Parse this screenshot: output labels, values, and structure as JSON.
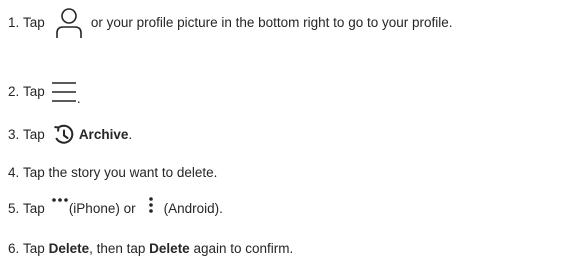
{
  "steps": [
    {
      "num": "1.",
      "pre": "Tap",
      "icon": "profile-icon",
      "post": "or your profile picture in the bottom right to go to your profile."
    },
    {
      "num": "2.",
      "pre": "Tap",
      "icon": "menu-icon",
      "post": "."
    },
    {
      "num": "3.",
      "pre": "Tap",
      "icon": "archive-icon",
      "bold": "Archive",
      "post": "."
    },
    {
      "num": "4.",
      "text": "Tap the story you want to delete."
    },
    {
      "num": "5.",
      "pre": "Tap",
      "icon1": "more-horizontal-icon",
      "mid": "(iPhone) or",
      "icon2": "more-vertical-icon",
      "post": "(Android)."
    },
    {
      "num": "6.",
      "pre": "Tap",
      "bold1": "Delete",
      "mid": ", then tap",
      "bold2": "Delete",
      "post": "again to confirm."
    }
  ],
  "colors": {
    "text": "#262626",
    "icon": "#262626"
  }
}
